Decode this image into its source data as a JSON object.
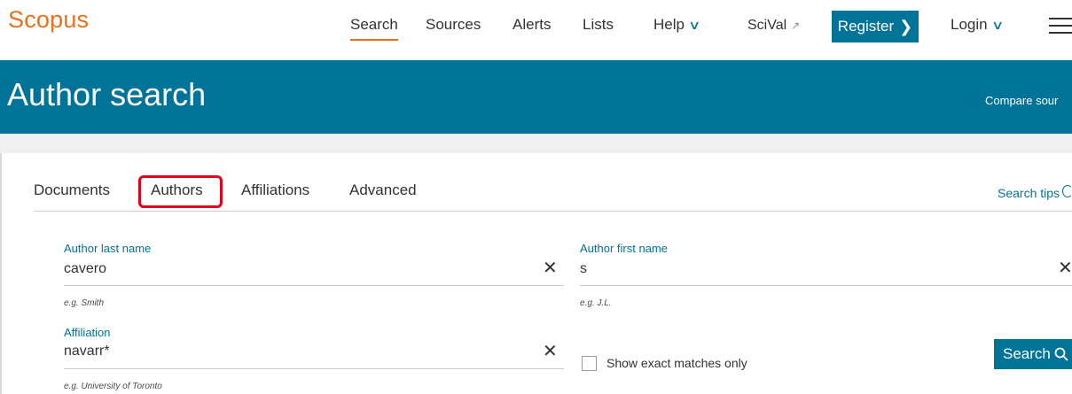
{
  "nav": {
    "logo": "Scopus",
    "items": [
      {
        "label": "Search"
      },
      {
        "label": "Sources"
      },
      {
        "label": "Alerts"
      },
      {
        "label": "Lists"
      },
      {
        "label": "Help"
      },
      {
        "label": "SciVal"
      }
    ],
    "register_label": "Register",
    "login_label": "Login"
  },
  "banner": {
    "title": "Author search",
    "compare_link": "Compare sour"
  },
  "tabs": [
    {
      "label": "Documents"
    },
    {
      "label": "Authors"
    },
    {
      "label": "Affiliations"
    },
    {
      "label": "Advanced"
    }
  ],
  "search_tips": "Search tips",
  "fields": {
    "last_name": {
      "label": "Author last name",
      "value": "cavero",
      "hint": "e.g. Smith"
    },
    "first_name": {
      "label": "Author first name",
      "value": "s",
      "hint": "e.g. J.L."
    },
    "affiliation": {
      "label": "Affiliation",
      "value": "navarr*",
      "hint": "e.g. University of Toronto"
    }
  },
  "exact_match_label": "Show exact matches only",
  "search_button_label": "Search",
  "colors": {
    "brand_orange": "#e9711c",
    "primary_blue": "#007398",
    "highlight_red": "#e3001b"
  }
}
